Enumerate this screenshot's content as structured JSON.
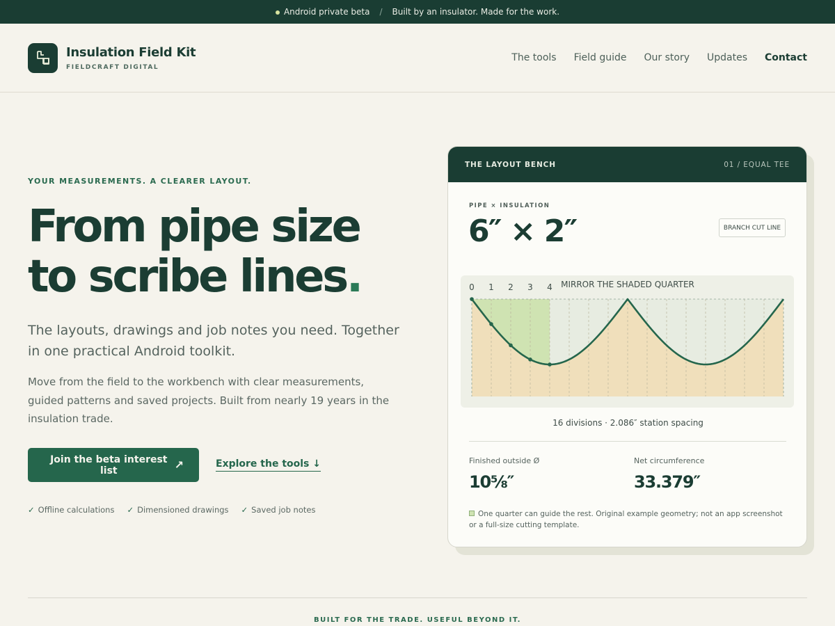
{
  "topbar": {
    "badge": "Android private beta",
    "separator": "/",
    "tagline": "Built by an insulator. Made for the work."
  },
  "brand": {
    "name": "Insulation Field Kit",
    "sub": "FIELDCRAFT DIGITAL",
    "logo_icon": "pipe-elbow-icon"
  },
  "nav": [
    {
      "label": "The tools"
    },
    {
      "label": "Field guide"
    },
    {
      "label": "Our story"
    },
    {
      "label": "Updates"
    },
    {
      "label": "Contact"
    }
  ],
  "hero": {
    "eyebrow": "YOUR MEASUREMENTS. A CLEARER LAYOUT.",
    "headline_line1": "From pipe size",
    "headline_line2": "to scribe lines",
    "headline_period": ".",
    "lede": "The layouts, drawings and job notes you need. Together in one practical Android toolkit.",
    "body": "Move from the field to the workbench with clear measurements, guided patterns and saved projects. Built from nearly 19 years in the insulation trade.",
    "cta_primary": "Join the beta interest list",
    "cta_primary_icon": "↗",
    "cta_secondary": "Explore the tools",
    "cta_secondary_icon": "↓",
    "features": [
      "Offline calculations",
      "Dimensioned drawings",
      "Saved job notes"
    ],
    "check_glyph": "✓"
  },
  "card": {
    "title": "THE LAYOUT BENCH",
    "step": "01 / EQUAL TEE",
    "pipe_label": "PIPE × INSULATION",
    "pipe_size": "6″ × 2″",
    "branch_button": "BRANCH CUT LINE",
    "diagram": {
      "caption": "MIRROR THE SHADED QUARTER",
      "station_labels": [
        "0",
        "1",
        "2",
        "3",
        "4"
      ],
      "divisions": 16,
      "colors": {
        "fill": "#f0dfbb",
        "quarter": "#cfe3b2",
        "curve": "#25664c"
      }
    },
    "divisions_text": "16 divisions · 2.086″ station spacing",
    "stats": [
      {
        "label": "Finished outside Ø",
        "value": "10⅝″"
      },
      {
        "label": "Net circumference",
        "value": "33.379″"
      }
    ],
    "note": "One quarter can guide the rest. Original example geometry; not an app screenshot or a full-size cutting template."
  },
  "footer": {
    "tagline": "BUILT FOR THE TRADE. USEFUL BEYOND IT."
  }
}
